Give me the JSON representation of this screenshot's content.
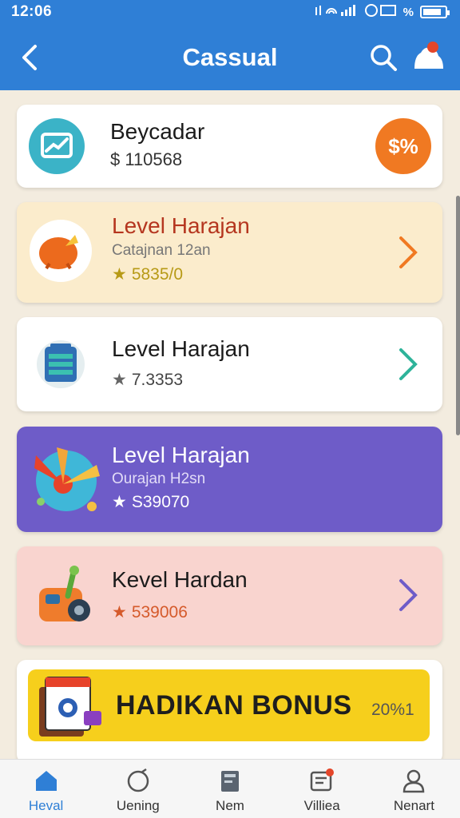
{
  "status_bar": {
    "time": "12:06",
    "battery_text": "%"
  },
  "app_bar": {
    "title": "Cassual"
  },
  "cards": [
    {
      "title": "Beycadar",
      "value": "$ 110568",
      "badge": "$%",
      "icon": "chart-monitor-icon"
    },
    {
      "title": "Level Harajan",
      "subtitle": "Catajnan 12an",
      "value": "5835/0",
      "icon": "orange-gem-icon",
      "bg": "#fbeccc"
    },
    {
      "title": "Level Harajan",
      "value": "7.3353",
      "icon": "clipboard-icon"
    },
    {
      "title": "Level Harajan",
      "subtitle": "Ourajan H2sn",
      "value": "S39070",
      "icon": "target-fan-icon",
      "bg": "#6e5cc8"
    },
    {
      "title": "Kevel Hardan",
      "value": "539006",
      "icon": "joystick-icon",
      "bg": "#f9d4cf"
    }
  ],
  "bonus": {
    "label": "HADIKAN BONUS",
    "count": "20%1"
  },
  "bottom_nav": [
    {
      "label": "Heval",
      "icon": "home-icon",
      "active": true
    },
    {
      "label": "Uening",
      "icon": "ring-icon"
    },
    {
      "label": "Nem",
      "icon": "book-icon"
    },
    {
      "label": "Villiea",
      "icon": "gift-box-icon"
    },
    {
      "label": "Nenart",
      "icon": "profile-icon"
    }
  ],
  "colors": {
    "app_bar": "#2f7fd6",
    "bonus_bg": "#f6cf1c",
    "badge_bg": "#f07922",
    "purple_card": "#6e5cc8"
  }
}
